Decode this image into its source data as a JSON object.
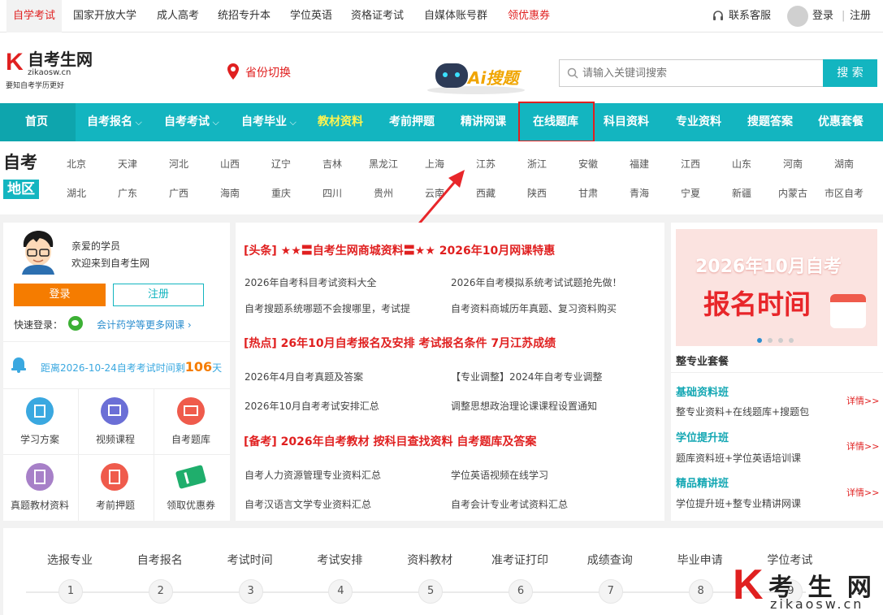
{
  "topbar": {
    "links": [
      "自学考试",
      "国家开放大学",
      "成人高考",
      "统招专升本",
      "学位英语",
      "资格证考试",
      "自媒体账号群",
      "领优惠券"
    ],
    "service": "联系客服",
    "login": "登录",
    "sep": "|",
    "register": "注册"
  },
  "header": {
    "logo_k": "K",
    "logo_name": "自考生网",
    "logo_domain": "zikaosw.cn",
    "logo_slogan": "要知自考学历更好",
    "province": "省份切换",
    "ai_label": "Ai搜题",
    "search_placeholder": "请输入关键词搜索",
    "search_button": "搜 索"
  },
  "nav": {
    "items": [
      "首页",
      "自考报名",
      "自考考试",
      "自考毕业",
      "教材资料",
      "考前押题",
      "精讲网课",
      "在线题库",
      "科目资料",
      "专业资料",
      "搜题答案",
      "优惠套餐"
    ]
  },
  "region": {
    "title1": "自考",
    "title2": "地区",
    "row1": [
      "北京",
      "天津",
      "河北",
      "山西",
      "辽宁",
      "吉林",
      "黑龙江",
      "上海",
      "江苏",
      "浙江",
      "安徽",
      "福建",
      "江西",
      "山东",
      "河南",
      "湖南"
    ],
    "row2": [
      "湖北",
      "广东",
      "广西",
      "海南",
      "重庆",
      "四川",
      "贵州",
      "云南",
      "西藏",
      "陕西",
      "甘肃",
      "青海",
      "宁夏",
      "新疆",
      "内蒙古",
      "市区自考"
    ]
  },
  "user": {
    "greet1": "亲爱的学员",
    "greet2": "欢迎来到自考生网",
    "login_btn": "登录",
    "register_btn": "注册",
    "quick_label": "快速登录：",
    "more_courses": "会计药学等更多网课",
    "countdown_prefix": "距离2026-10-24自考考试时间剩",
    "countdown_days": "106",
    "countdown_suffix": "天",
    "icons": [
      "学习方案",
      "视频课程",
      "自考题库",
      "真题教材资料",
      "考前押题",
      "领取优惠券"
    ]
  },
  "news": {
    "headline": "[头条] ★★〓自考生网商城资料〓★★  2026年10月网课特惠",
    "top_links": [
      "2026年自考科目考试资料大全",
      "2026年自考模拟系统考试试题抢先做！",
      "自考搜题系统哪题不会搜哪里，考试提",
      "自考资料商城历年真题、复习资料购买"
    ],
    "hot": "[热点]  26年10月自考报名及安排   考试报名条件   7月江苏成绩",
    "hot_links": [
      "2026年4月自考真题及答案",
      "【专业调整】2024年自考专业调整",
      "2026年10月自考考试安排汇总",
      "调整思想政治理论课课程设置通知"
    ],
    "prep": "[备考]  2026年自考教材   按科目查找资料   自考题库及答案",
    "prep_links": [
      "自考人力资源管理专业资料汇总",
      "学位英语视频在线学习",
      "自考汉语言文学专业资料汇总",
      "自考会计专业考试资料汇总"
    ]
  },
  "promo": {
    "banner_line1": "2026年10月自考",
    "banner_line2": "报名时间",
    "section_title": "整专业套餐",
    "packages": [
      {
        "name": "基础资料班",
        "desc": "整专业资料+在线题库+搜题包",
        "more": "详情>>"
      },
      {
        "name": "学位提升班",
        "desc": "题库资料班+学位英语培训课",
        "more": "详情>>"
      },
      {
        "name": "精品精讲班",
        "desc": "学位提升班+整专业精讲网课",
        "more": "详情>>"
      }
    ]
  },
  "steps": {
    "labels": [
      "选报专业",
      "自考报名",
      "考试时间",
      "考试安排",
      "资料教材",
      "准考证打印",
      "成绩查询",
      "毕业申请",
      "学位考试"
    ],
    "numbers": [
      "1",
      "2",
      "3",
      "4",
      "5",
      "6",
      "7",
      "8",
      "9"
    ]
  },
  "watermark": {
    "k": "K",
    "name": "考 生 网",
    "domain": "zikaosw.cn"
  },
  "colors": {
    "accent": "#13b5c0",
    "red": "#e02020",
    "orange": "#f57c00",
    "highlight_nav": "#fff44f"
  }
}
